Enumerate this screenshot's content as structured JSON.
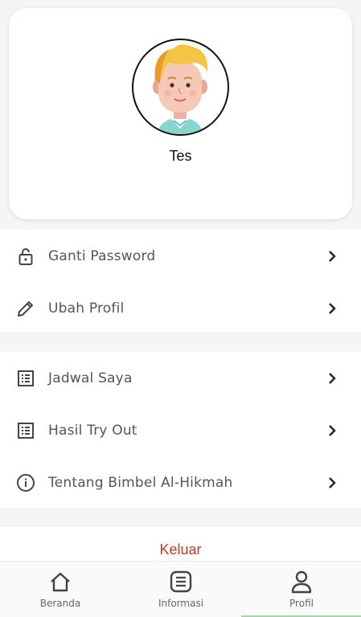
{
  "profile": {
    "name": "Tes",
    "avatar_icon": "user-avatar-illustration"
  },
  "menu_group_1": [
    {
      "label": "Ganti Password",
      "icon": "lock-icon"
    },
    {
      "label": "Ubah Profil",
      "icon": "pencil-icon"
    }
  ],
  "menu_group_2": [
    {
      "label": "Jadwal Saya",
      "icon": "list-icon"
    },
    {
      "label": "Hasil Try Out",
      "icon": "list-icon"
    },
    {
      "label": "Tentang Bimbel Al-Hikmah",
      "icon": "info-icon"
    }
  ],
  "logout": {
    "label": "Keluar",
    "color": "#c0392b"
  },
  "bottom_nav": {
    "items": [
      {
        "label": "Beranda",
        "icon": "home-icon"
      },
      {
        "label": "Informasi",
        "icon": "document-icon"
      },
      {
        "label": "Profil",
        "icon": "person-icon"
      }
    ],
    "active": "Profil",
    "indicator_color": "#a5d6a7"
  }
}
